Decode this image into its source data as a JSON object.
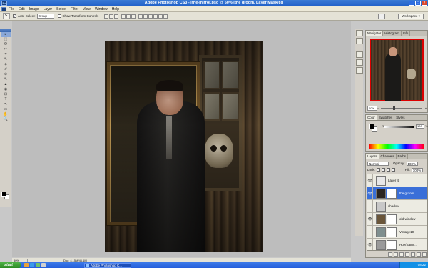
{
  "window": {
    "title": "Adobe Photoshop CS3 - [the-mirror.psd @ 50% (the groom, Layer Mask/8)]",
    "ps_logo": "Ps",
    "minimize": "_",
    "maximize": "□",
    "close": "×"
  },
  "menu": [
    "File",
    "Edit",
    "Image",
    "Layer",
    "Select",
    "Filter",
    "View",
    "Window",
    "Help"
  ],
  "options": {
    "tool_icon": "move-tool",
    "auto_select_label": "Auto-Select:",
    "auto_select_value": "Group",
    "transform_label": "Show Transform Controls",
    "workspace_label": "Workspace ▾"
  },
  "toolbox": {
    "tools": [
      "▸",
      "⬚",
      "ʘ",
      "✂",
      "⌗",
      "✎",
      "◈",
      "✐",
      "⊘",
      "✎",
      "▲",
      "◉",
      "⊡",
      "T",
      "↖",
      "▭",
      "✋",
      "🔍"
    ]
  },
  "status": {
    "zoom": "50%",
    "docsize": "Doc: 4.15M/46.1M"
  },
  "navigator": {
    "tabs": [
      "Navigator",
      "Histogram",
      "Info"
    ],
    "zoom_value": "50%"
  },
  "color": {
    "tabs": [
      "Color",
      "Swatches",
      "Styles"
    ],
    "channel_label": "K",
    "channel_value": "100",
    "channel_unit": "%",
    "channel_level": 1.0
  },
  "layers": {
    "tabs": [
      "Layers",
      "Channels",
      "Paths"
    ],
    "blend_mode": "Normal",
    "opacity_label": "Opacity:",
    "opacity_value": "100%",
    "lock_label": "Lock:",
    "fill_label": "Fill:",
    "fill_value": "100%",
    "items": [
      {
        "name": "Layer 4",
        "visible": true,
        "selected": false,
        "thumb_color": "#e8e8e8",
        "has_mask": false
      },
      {
        "name": "the groom",
        "visible": true,
        "selected": true,
        "thumb_color": "#2a2420",
        "has_mask": true
      },
      {
        "name": "shadow",
        "visible": false,
        "selected": false,
        "thumb_color": "#c8c8c8",
        "has_mask": false
      },
      {
        "name": "old-window",
        "visible": true,
        "selected": false,
        "thumb_color": "#6a563a",
        "has_mask": true
      },
      {
        "name": "Vintage10",
        "visible": false,
        "selected": false,
        "thumb_color": "#7f8f8f",
        "has_mask": true
      },
      {
        "name": "Hue/Satur...",
        "visible": true,
        "selected": false,
        "thumb_color": "#9a9a9a",
        "has_mask": true
      }
    ]
  },
  "taskbar": {
    "start_label": "start",
    "task_label": "Adobe Photoshop C...",
    "clock": "08:22"
  },
  "colors": {
    "titlebar": "#2a6ad0",
    "selected_layer": "#3a6fd8",
    "canvas_bg": "#bdbdbd"
  }
}
